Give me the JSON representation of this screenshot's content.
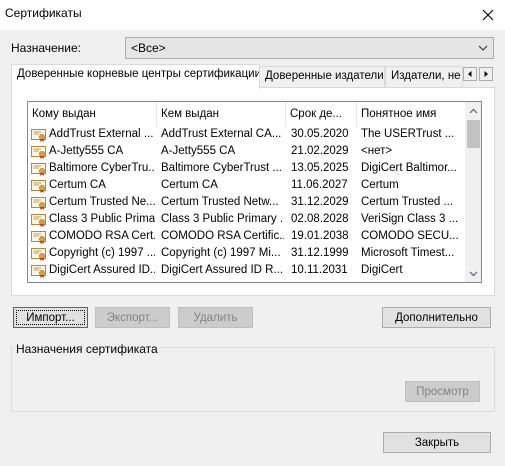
{
  "window": {
    "title": "Сертификаты",
    "close_icon": "close-icon"
  },
  "purpose": {
    "label": "Назначение:",
    "value": "<Все>"
  },
  "tabs": [
    {
      "label": "Доверенные корневые центры сертификации",
      "active": true
    },
    {
      "label": "Доверенные издатели",
      "active": false
    },
    {
      "label": "Издатели, не",
      "active": false
    }
  ],
  "list": {
    "columns": [
      "Кому выдан",
      "Кем выдан",
      "Срок де...",
      "Понятное имя"
    ],
    "rows": [
      {
        "issued_to": "AddTrust External ...",
        "issued_by": "AddTrust External CA...",
        "expires": "30.05.2020",
        "friendly": "The USERTrust ..."
      },
      {
        "issued_to": "A-Jetty555 CA",
        "issued_by": "A-Jetty555 CA",
        "expires": "21.02.2029",
        "friendly": "<нет>"
      },
      {
        "issued_to": "Baltimore CyberTru...",
        "issued_by": "Baltimore CyberTrust ...",
        "expires": "13.05.2025",
        "friendly": "DigiCert Baltimor..."
      },
      {
        "issued_to": "Certum CA",
        "issued_by": "Certum CA",
        "expires": "11.06.2027",
        "friendly": "Certum"
      },
      {
        "issued_to": "Certum Trusted Ne...",
        "issued_by": "Certum Trusted Netw...",
        "expires": "31.12.2029",
        "friendly": "Certum Trusted ..."
      },
      {
        "issued_to": "Class 3 Public Prima...",
        "issued_by": "Class 3 Public Primary ...",
        "expires": "02.08.2028",
        "friendly": "VeriSign Class 3 ..."
      },
      {
        "issued_to": "COMODO RSA Cert...",
        "issued_by": "COMODO RSA Certific...",
        "expires": "19.01.2038",
        "friendly": "COMODO SECU..."
      },
      {
        "issued_to": "Copyright (c) 1997 ...",
        "issued_by": "Copyright (c) 1997 Mi...",
        "expires": "31.12.1999",
        "friendly": "Microsoft Timest..."
      },
      {
        "issued_to": "DigiCert Assured ID...",
        "issued_by": "DigiCert Assured ID R...",
        "expires": "10.11.2031",
        "friendly": "DigiCert"
      }
    ]
  },
  "buttons": {
    "import": "Импорт...",
    "export": "Экспорт...",
    "delete": "Удалить",
    "advanced": "Дополнительно",
    "view": "Просмотр",
    "close": "Закрыть"
  },
  "group": {
    "label": "Назначения сертификата"
  },
  "colors": {
    "accent": "#0078d7",
    "icon_gold": "#d9a23c"
  }
}
